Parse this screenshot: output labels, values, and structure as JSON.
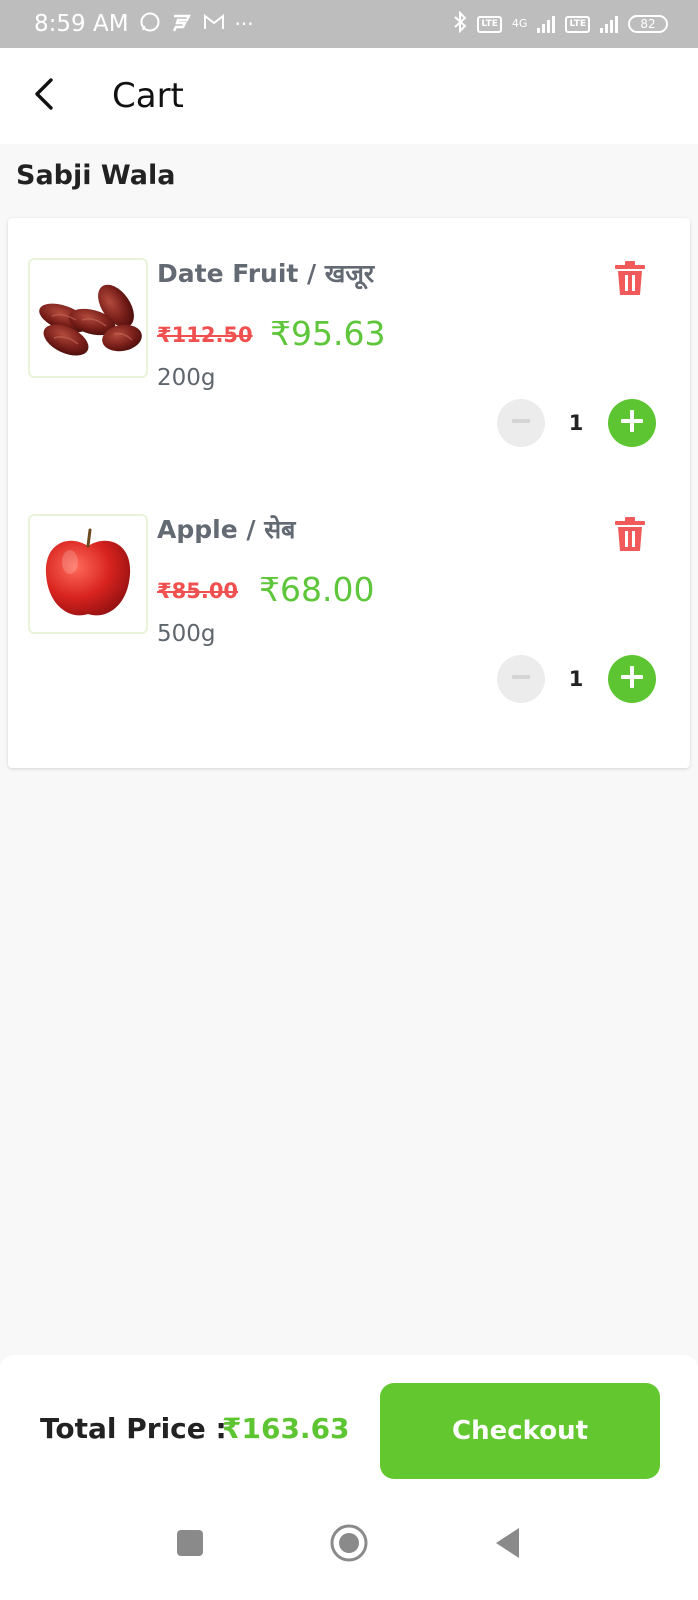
{
  "status_bar": {
    "time": "8:59 AM",
    "battery": "82",
    "lte": "LTE",
    "network": "4G",
    "dots": "···",
    "icons": [
      "whatsapp-icon",
      "app-icon",
      "gmail-icon",
      "bluetooth-icon",
      "signal-icon",
      "battery-icon"
    ]
  },
  "header": {
    "title": "Cart",
    "back_icon": "chevron-left-icon"
  },
  "store": {
    "name": "Sabji Wala"
  },
  "cart_items": [
    {
      "name": "Date Fruit / खजूर",
      "old_price": "₹112.50",
      "price": "₹95.63",
      "weight": "200g",
      "quantity": "1",
      "image": "dates-image"
    },
    {
      "name": "Apple / सेब",
      "old_price": "₹85.00",
      "price": "₹68.00",
      "weight": "500g",
      "quantity": "1",
      "image": "apple-image"
    }
  ],
  "footer": {
    "total_label": "Total Price :",
    "total_value": "₹163.63",
    "checkout_label": "Checkout"
  },
  "colors": {
    "accent_green": "#63c72f",
    "price_green": "#5ec63a",
    "strike_red": "#f05050",
    "delete_red": "#f05a5a"
  }
}
